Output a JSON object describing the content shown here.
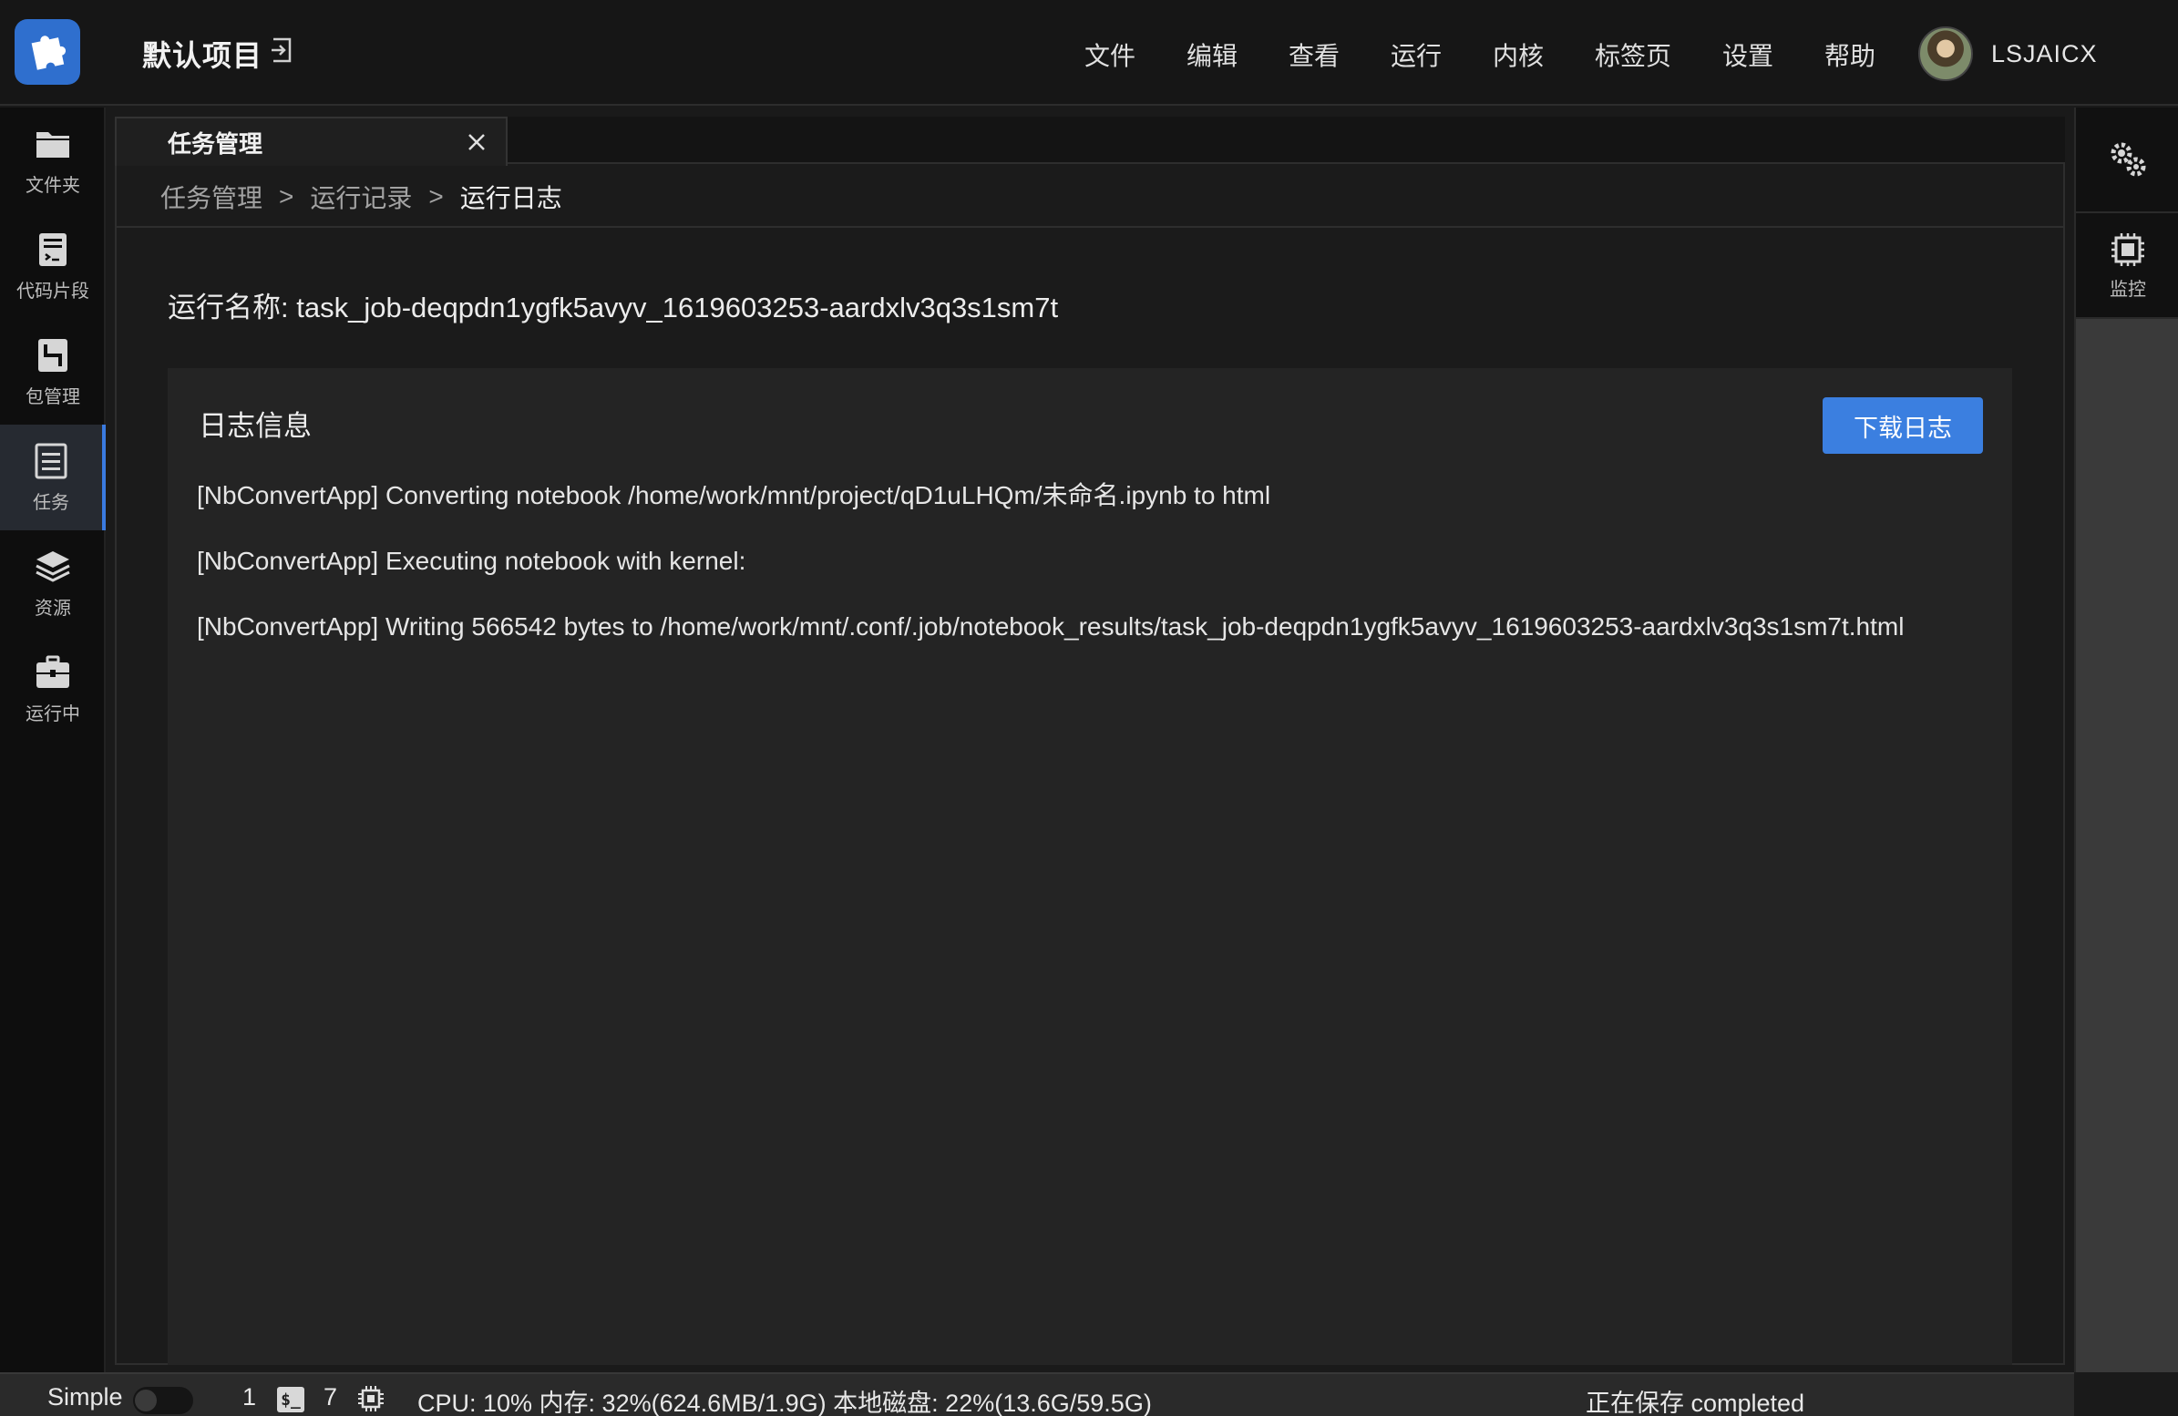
{
  "header": {
    "project_title": "默认项目",
    "menu": [
      "文件",
      "编辑",
      "查看",
      "运行",
      "内核",
      "标签页",
      "设置",
      "帮助"
    ],
    "username": "LSJAICX"
  },
  "left_sidebar": {
    "items": [
      {
        "label": "文件夹",
        "icon": "folder-icon"
      },
      {
        "label": "代码片段",
        "icon": "code-snippet-icon"
      },
      {
        "label": "包管理",
        "icon": "package-icon"
      },
      {
        "label": "任务",
        "icon": "task-list-icon",
        "active": true
      },
      {
        "label": "资源",
        "icon": "layers-icon"
      },
      {
        "label": "运行中",
        "icon": "briefcase-icon"
      }
    ]
  },
  "right_sidebar": {
    "items": [
      {
        "label": "",
        "icon": "gears-icon"
      },
      {
        "label": "监控",
        "icon": "chip-icon"
      }
    ]
  },
  "tab": {
    "label": "任务管理"
  },
  "breadcrumb": {
    "items": [
      "任务管理",
      "运行记录"
    ],
    "separator": ">",
    "current": "运行日志"
  },
  "run": {
    "name_label": "运行名称:",
    "name_value": "task_job-deqpdn1ygfk5avyv_1619603253-aardxlv3q3s1sm7t"
  },
  "log": {
    "title": "日志信息",
    "download_label": "下载日志",
    "lines": [
      "[NbConvertApp] Converting notebook /home/work/mnt/project/qD1uLHQm/未命名.ipynb to html",
      "[NbConvertApp] Executing notebook with kernel:",
      "[NbConvertApp] Writing 566542 bytes to /home/work/mnt/.conf/.job/notebook_results/task_job-deqpdn1ygfk5avyv_1619603253-aardxlv3q3s1sm7t.html"
    ]
  },
  "statusbar": {
    "mode_label": "Simple",
    "terminal_count": "1",
    "kernel_count": "7",
    "resources": "CPU:  10% 内存:  32%(624.6MB/1.9G) 本地磁盘:  22%(13.6G/59.5G)",
    "save_status": "正在保存 completed"
  },
  "colors": {
    "accent": "#3b7fe0",
    "background": "#1b1b1b",
    "panel": "#242424"
  }
}
